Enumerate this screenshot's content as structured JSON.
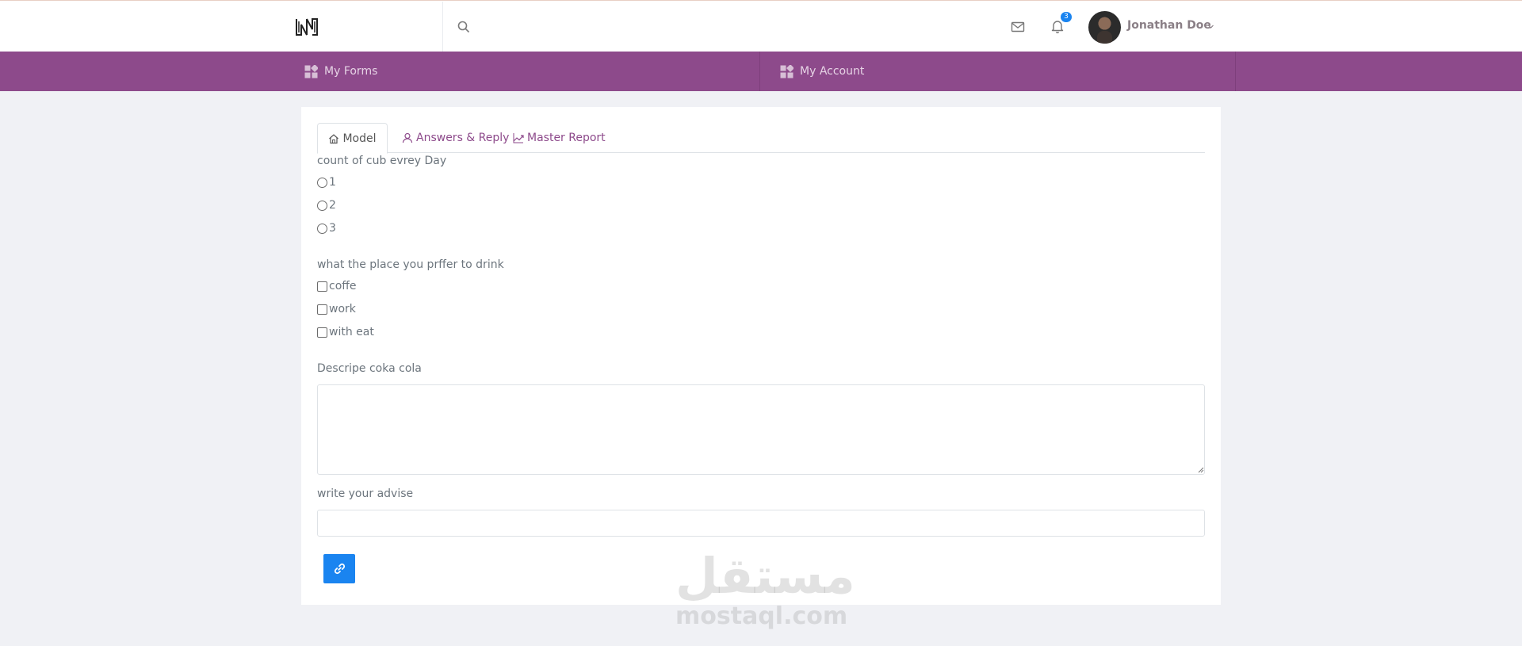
{
  "header": {
    "search": {
      "placeholder": "",
      "value": ""
    },
    "notifications": {
      "count": "3"
    },
    "user": {
      "name": "Jonathan Doe"
    }
  },
  "nav": {
    "items": [
      {
        "label": "My Forms",
        "icon": "grid-icon"
      },
      {
        "label": "My Account",
        "icon": "grid-icon"
      }
    ]
  },
  "tabs": [
    {
      "label": "Model",
      "icon": "home-icon",
      "active": true
    },
    {
      "label": "Answers & Reply",
      "icon": "user-icon",
      "active": false
    },
    {
      "label": "Master Report",
      "icon": "chart-line-icon",
      "active": false
    }
  ],
  "form": {
    "q1": {
      "label": "count of cub evrey Day",
      "type": "radio",
      "options": [
        "1",
        "2",
        "3"
      ]
    },
    "q2": {
      "label": "what the place you prffer to drink",
      "type": "checkbox",
      "options": [
        "coffe",
        "work",
        "with eat"
      ]
    },
    "q3": {
      "label": "Descripe coka cola",
      "type": "textarea",
      "value": ""
    },
    "q4": {
      "label": "write your advise",
      "type": "text",
      "value": ""
    },
    "submit": {
      "icon": "link-icon"
    }
  },
  "watermark": {
    "arabic": "مستقل",
    "latin": "mostaql.com"
  },
  "colors": {
    "primary_nav": "#8d4a8b",
    "accent_button": "#1a84f0",
    "badge": "#1a84f0"
  }
}
